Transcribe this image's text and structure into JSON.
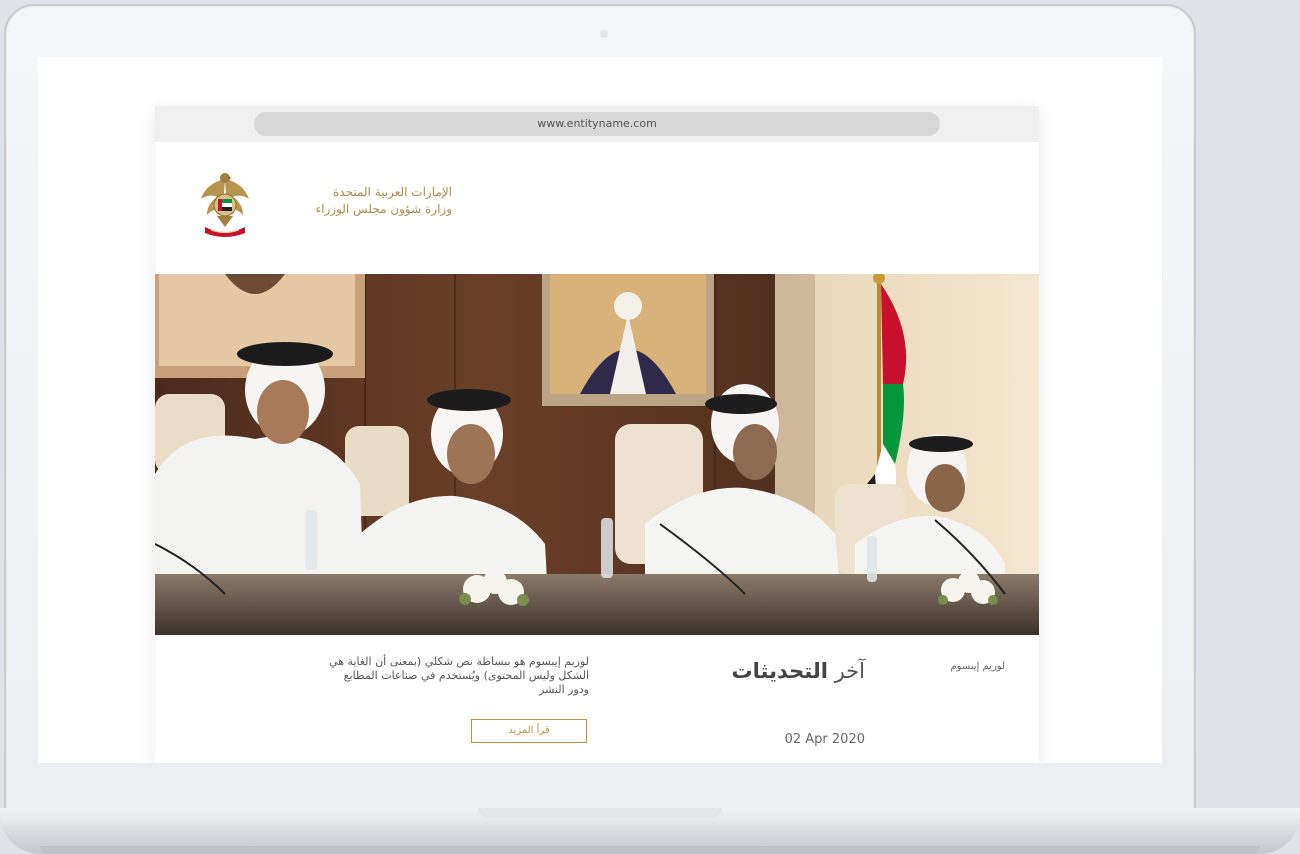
{
  "browser": {
    "url": "www.entityname.com"
  },
  "header": {
    "brand_line1": "الإمارات العربية المتحدة",
    "brand_line2": "وزارة شؤون مجلس الوزراء"
  },
  "content": {
    "tag_label": "لوريم إيبسوم",
    "section_title_prefix": "آخر",
    "section_title_bold": "التحديثات",
    "date": "02 Apr 2020",
    "excerpt": "لوريم إيبسوم هو ببساطة نص شكلي (بمعنى أن الغاية هي الشكل وليس المحتوى) ويُستخدم في صناعات المطابع ودور النشر",
    "read_more": "قرأ المزيد"
  },
  "colors": {
    "gold": "#b8954f",
    "flag_red": "#c8102e",
    "flag_green": "#009639"
  }
}
